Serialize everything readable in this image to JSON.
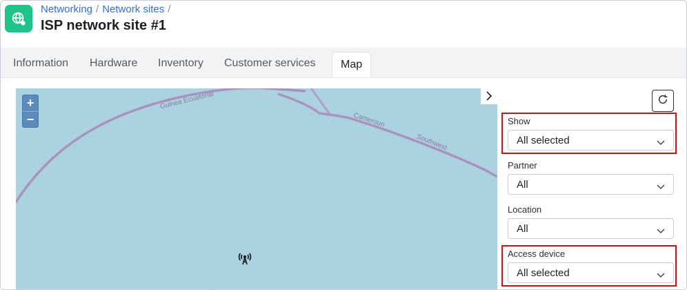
{
  "breadcrumb": {
    "items": [
      "Networking",
      "Network sites"
    ],
    "separator": "/"
  },
  "page": {
    "title": "ISP network site #1",
    "icon": "globe-network-icon"
  },
  "tabs": [
    {
      "label": "Information",
      "active": false
    },
    {
      "label": "Hardware",
      "active": false
    },
    {
      "label": "Inventory",
      "active": false
    },
    {
      "label": "Customer services",
      "active": false
    },
    {
      "label": "Map",
      "active": true
    }
  ],
  "map": {
    "zoom_in_label": "+",
    "zoom_out_label": "−",
    "labels": {
      "road_1": "Guinea Ecuatorial",
      "road_2": "Cameroun",
      "road_3": "Southwest"
    },
    "marker_icon": "radio-tower-icon",
    "water_color": "#aad3df",
    "border_color": "#b0a0c8"
  },
  "sidebar": {
    "refresh_icon": "refresh-icon",
    "toggle_icon": "chevron-right-icon",
    "filters": {
      "show": {
        "label": "Show",
        "value": "All selected",
        "highlighted": true
      },
      "partner": {
        "label": "Partner",
        "value": "All",
        "highlighted": false
      },
      "location": {
        "label": "Location",
        "value": "All",
        "highlighted": false
      },
      "access_device": {
        "label": "Access device",
        "value": "All selected",
        "highlighted": true
      }
    }
  },
  "colors": {
    "brand": "#1ec48a",
    "link": "#2f6fd6",
    "highlight": "#c01818",
    "zoom_control": "#5a8bbd"
  }
}
